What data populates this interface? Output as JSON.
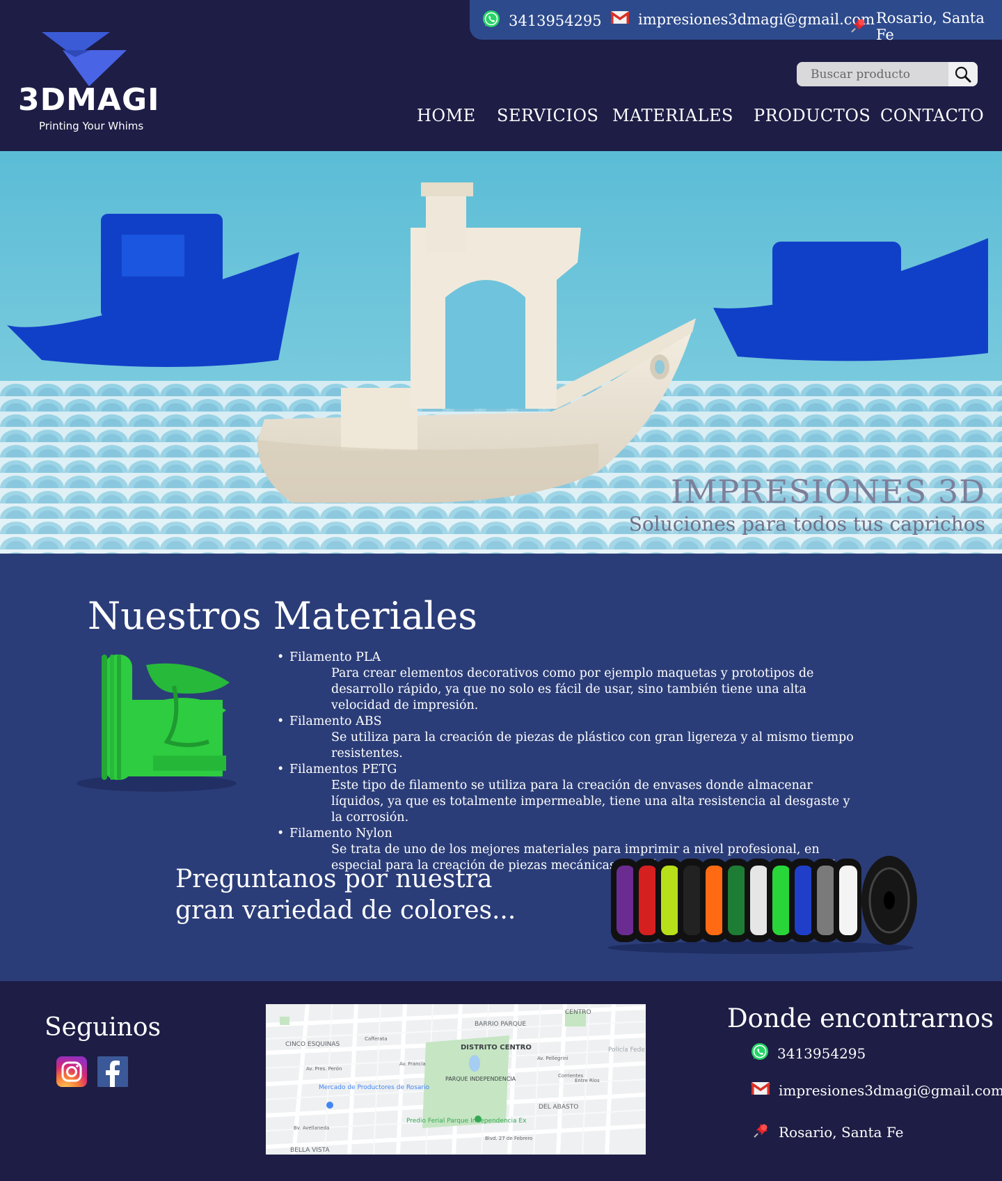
{
  "contact_bar": {
    "phone": "3413954295",
    "email": "impresiones3dmagi@gmail.com",
    "location": "Rosario, Santa Fe"
  },
  "logo": {
    "brand": "3DMAGI",
    "tagline": "Printing Your Whims"
  },
  "search": {
    "placeholder": "Buscar producto"
  },
  "nav": {
    "home": "HOME",
    "servicios": "SERVICIOS",
    "materiales": "MATERIALES",
    "productos": "PRODUCTOS",
    "contacto": "CONTACTO"
  },
  "hero": {
    "title": "IMPRESIONES 3D",
    "subtitle": "Soluciones para todos tus caprichos"
  },
  "materials": {
    "title": "Nuestros Materiales",
    "items": [
      {
        "name": "Filamento PLA",
        "desc": "Para crear elementos decorativos como por ejemplo maquetas y prototipos de desarrollo rápido, ya que no solo es fácil de usar, sino también tiene una alta velocidad de impresión."
      },
      {
        "name": "Filamento ABS",
        "desc": "Se utiliza para la creación de piezas de plástico con gran ligereza y al mismo tiempo resistentes."
      },
      {
        "name": "Filamentos PETG",
        "desc": "Este tipo de filamento se utiliza para la creación de envases donde almacenar líquidos, ya que es totalmente impermeable, tiene una alta resistencia al desgaste y la corrosión."
      },
      {
        "name": "Filamento Nylon",
        "desc": "Se trata de uno de los mejores materiales para imprimir a nivel profesional, en especial para la creación de piezas mecánicas de plástico en productos comerciales."
      }
    ],
    "colors_line1": "Preguntanos por nuestra",
    "colors_line2": "gran variedad de colores..."
  },
  "footer": {
    "seguinos": "Seguinos",
    "donde": "Donde encontrarnos",
    "phone": "3413954295",
    "email": "impresiones3dmagi@gmail.com",
    "location": "Rosario, Santa Fe"
  },
  "map": {
    "labels": {
      "centro": "CENTRO",
      "barrio_parque": "BARRIO PARQUE",
      "cinco_esquinas": "CINCO ESQUINAS",
      "distrito_centro": "DISTRITO CENTRO",
      "parque_independencia": "PARQUE INDEPENDENCIA",
      "policia": "Policía Fede",
      "mercado": "Mercado de Productores de Rosario",
      "predio": "Predio Ferial Parque Independencia Ex",
      "del_abasto": "DEL ABASTO",
      "bella_vista": "BELLA VISTA",
      "av_pellegrini": "Av. Pellegrini",
      "av_pres_peron": "Av. Pres. Perón",
      "blvd_27": "Blvd. 27 de Febrero",
      "corrientes": "Corrientes",
      "entre_rios": "Entre Ríos",
      "av_francia": "Av. Francia",
      "cafferata": "Cafferata",
      "bv_avellaneda": "Bv. Avellaneda"
    }
  },
  "colors": {
    "header_bg": "#1e1d45",
    "contact_bar": "#2d4a8c",
    "materials_bg": "#2b3d78",
    "whatsapp": "#25d366",
    "gmail_red": "#d93025"
  }
}
